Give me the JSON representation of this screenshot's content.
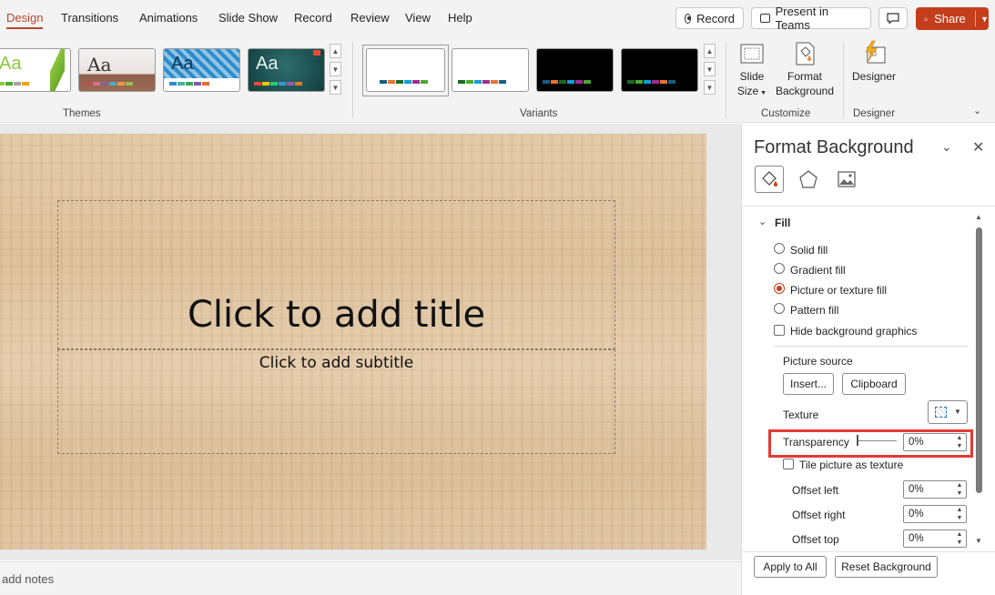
{
  "tabs": [
    "Design",
    "Transitions",
    "Animations",
    "Slide Show",
    "Record",
    "Review",
    "View",
    "Help"
  ],
  "top_actions": {
    "record": "Record",
    "present_teams": "Present in Teams",
    "share": "Share"
  },
  "ribbon": {
    "themes_label": "Themes",
    "variants_label": "Variants",
    "customize_label": "Customize",
    "designer_group_label": "Designer",
    "theme_thumb_text": "Aa",
    "slide_size": [
      "Slide",
      "Size"
    ],
    "format_background": [
      "Format",
      "Background"
    ],
    "designer": "Designer"
  },
  "slide": {
    "title_placeholder": "Click to add title",
    "subtitle_placeholder": "Click to add subtitle"
  },
  "notes": {
    "text": "add notes"
  },
  "pane": {
    "title": "Format Background",
    "section": "Fill",
    "fill_options": [
      "Solid fill",
      "Gradient fill",
      "Picture or texture fill",
      "Pattern fill"
    ],
    "selected_fill": "Picture or texture fill",
    "hide_background": "Hide background graphics",
    "picture_source": "Picture source",
    "insert": "Insert...",
    "clipboard": "Clipboard",
    "texture": "Texture",
    "transparency": "Transparency",
    "transparency_value": "0%",
    "tile": "Tile picture as texture",
    "offset_left": "Offset left",
    "offset_left_value": "0%",
    "offset_right": "Offset right",
    "offset_right_value": "0%",
    "offset_top": "Offset top",
    "offset_top_value": "0%",
    "apply_all": "Apply to All",
    "reset": "Reset Background"
  },
  "colors": {
    "accent": "#c43e1c",
    "highlight_box": "#e53935"
  }
}
